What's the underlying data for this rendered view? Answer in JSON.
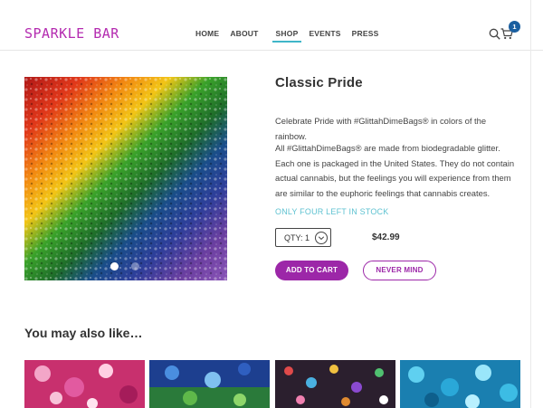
{
  "brand": {
    "logo": "SPARKLE BAR",
    "accent": "#b42bb0"
  },
  "nav": {
    "items": [
      {
        "label": "HOME",
        "active": false
      },
      {
        "label": "ABOUT",
        "active": false
      },
      {
        "label": "SHOP",
        "active": true
      },
      {
        "label": "EVENTS",
        "active": false
      },
      {
        "label": "PRESS",
        "active": false
      }
    ],
    "icons": [
      "search-icon",
      "cart-icon"
    ],
    "cart_count": "1"
  },
  "product": {
    "title": "Classic Pride",
    "description_1": "Celebrate Pride with #GlittahDimeBags® in colors of the rainbow.",
    "description_2": "All #GlittahDimeBags® are made from biodegradable glitter. Each one is packaged in the United States. They do not contain actual cannabis, but the feelings you will experience from them are similar to the euphoric feelings that cannabis creates.",
    "stock": "ONLY FOUR LEFT IN STOCK",
    "qty_label": "QTY: 1",
    "price": "$42.99",
    "add_to_cart": "ADD TO CART",
    "never_mind": "NEVER MIND",
    "image_dots": 2,
    "active_dot": 1
  },
  "related": {
    "title": "You may also like…"
  },
  "colors": {
    "primary_button": "#9c27a8",
    "stock_text": "#5ec2d1",
    "active_nav_underline": "#3fb6c9",
    "cart_badge": "#1a5fa0"
  }
}
